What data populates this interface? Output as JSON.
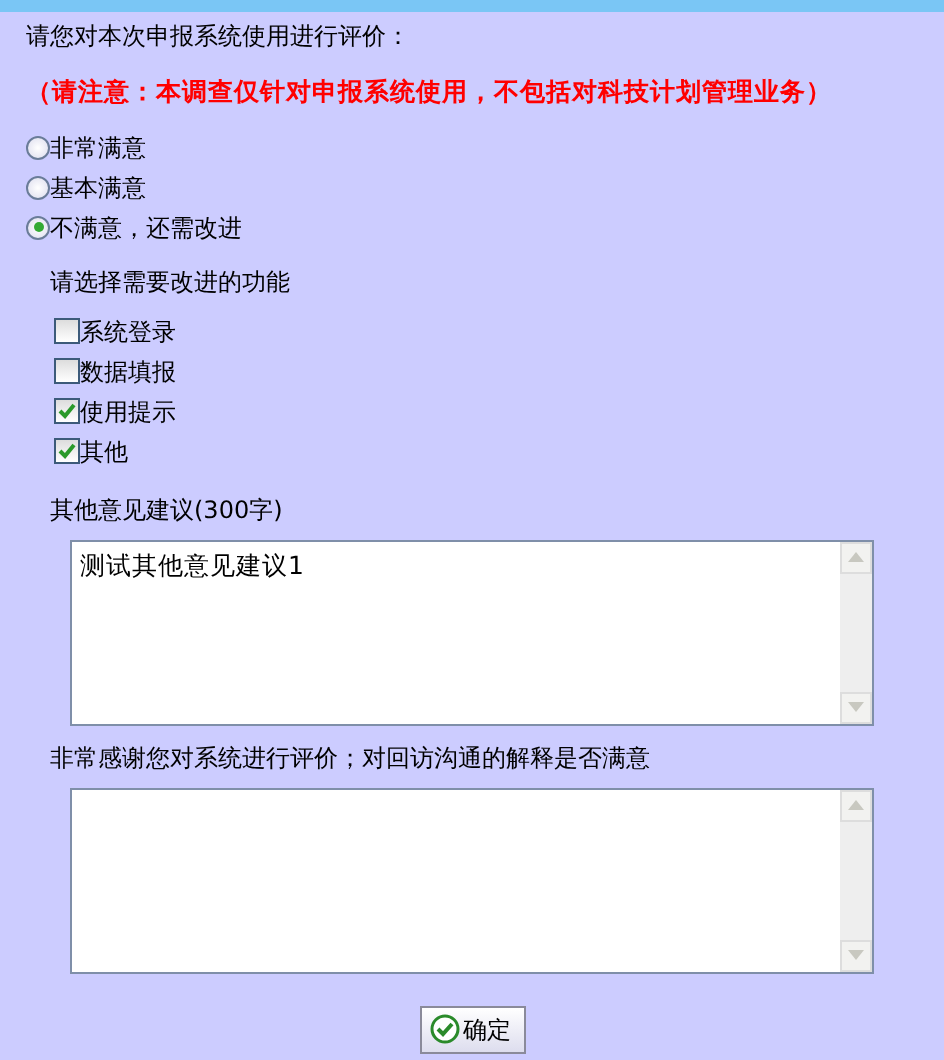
{
  "prompt": "请您对本次申报系统使用进行评价：",
  "notice": "（请注意：本调查仅针对申报系统使用，不包括对科技计划管理业务）",
  "ratings": [
    {
      "label": "非常满意",
      "selected": false
    },
    {
      "label": "基本满意",
      "selected": false
    },
    {
      "label": "不满意，还需改进",
      "selected": true
    }
  ],
  "improve_prompt": "请选择需要改进的功能",
  "features": [
    {
      "label": "系统登录",
      "checked": false
    },
    {
      "label": "数据填报",
      "checked": false
    },
    {
      "label": "使用提示",
      "checked": true
    },
    {
      "label": "其他",
      "checked": true
    }
  ],
  "suggestions": {
    "label": "其他意见建议(300字)",
    "value": "测试其他意见建议1"
  },
  "followup": {
    "label": "非常感谢您对系统进行评价；对回访沟通的解释是否满意"
  },
  "submit_button": "确定"
}
